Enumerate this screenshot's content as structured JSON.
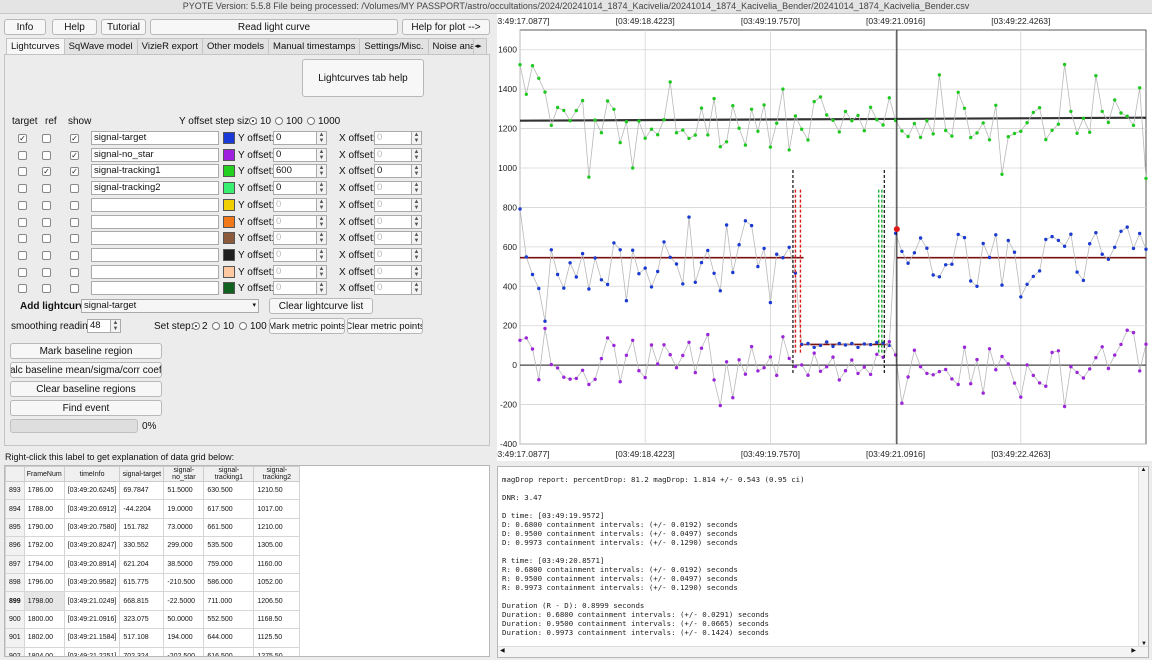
{
  "window_title": "PYOTE Version: 5.5.8  File being processed: /Volumes/MY PASSPORT/astro/occultations/2024/20241014_1874_Kacivelia/20241014_1874_Kacivelia_Bender/20241014_1874_Kacivelia_Bender.csv",
  "toolbar": {
    "info": "Info",
    "help": "Help",
    "tutorial": "Tutorial",
    "read_lightcurve": "Read light curve",
    "help_plot": "Help for plot -->"
  },
  "tabs": [
    "Lightcurves",
    "SqWave model",
    "VizieR export",
    "Other models",
    "Manual timestamps",
    "Settings/Misc.",
    "Noise analysis/"
  ],
  "lightcurves_tab_help": "Lightcurves tab help",
  "col_headers": {
    "target": "target",
    "ref": "ref",
    "show": "show",
    "offset_step": "Y offset step size:"
  },
  "offset_steps": [
    "10",
    "100",
    "1000"
  ],
  "y_offset_label": "Y offset:",
  "x_offset_label": "X offset:",
  "curves": [
    {
      "name": "signal-target",
      "color": "#1a3ad8",
      "target": true,
      "ref": false,
      "show": true,
      "y": "0",
      "x": "0",
      "active": true
    },
    {
      "name": "signal-no_star",
      "color": "#a020e0",
      "target": false,
      "ref": false,
      "show": true,
      "y": "0",
      "x": "0",
      "active": true
    },
    {
      "name": "signal-tracking1",
      "color": "#22d022",
      "target": false,
      "ref": true,
      "show": true,
      "y": "600",
      "x": "0",
      "active": true
    },
    {
      "name": "signal-tracking2",
      "color": "#38ef70",
      "target": false,
      "ref": false,
      "show": false,
      "y": "0",
      "x": "0",
      "active": true
    },
    {
      "name": "",
      "color": "#f0d000",
      "target": false,
      "ref": false,
      "show": false,
      "y": "0",
      "x": "0",
      "active": false
    },
    {
      "name": "",
      "color": "#f07818",
      "target": false,
      "ref": false,
      "show": false,
      "y": "0",
      "x": "0",
      "active": false
    },
    {
      "name": "",
      "color": "#8b5a3c",
      "target": false,
      "ref": false,
      "show": false,
      "y": "0",
      "x": "0",
      "active": false
    },
    {
      "name": "",
      "color": "#202020",
      "target": false,
      "ref": false,
      "show": false,
      "y": "0",
      "x": "0",
      "active": false
    },
    {
      "name": "",
      "color": "#ffc8a0",
      "target": false,
      "ref": false,
      "show": false,
      "y": "0",
      "x": "0",
      "active": false
    },
    {
      "name": "",
      "color": "#106020",
      "target": false,
      "ref": false,
      "show": false,
      "y": "0",
      "x": "0",
      "active": false
    }
  ],
  "add_lightcurve_label": "Add lightcurve",
  "add_lightcurve_value": "signal-target",
  "clear_lightcurve_list": "Clear lightcurve list",
  "smoothing_label": "smoothing readings",
  "smoothing_value": "48",
  "set_step_label": "Set step:",
  "set_steps": [
    "2",
    "10",
    "100"
  ],
  "mark_metric": "Mark metric points",
  "clear_metric": "Clear metric points",
  "mark_baseline": "Mark baseline region",
  "calc_baseline": "Calc baseline mean/sigma/corr coeffs",
  "clear_baseline": "Clear baseline regions",
  "find_event": "Find event",
  "progress_percent": "0%",
  "progress_value": 0,
  "grid_hint": "Right-click this label to get explanation of data grid below:",
  "grid": {
    "headers": [
      "FrameNum",
      "timeInfo",
      "signal-target",
      "signal-no_star",
      "signal-tracking1",
      "signal-tracking2"
    ],
    "rows": [
      {
        "id": "893",
        "cells": [
          "1786.00",
          "[03:49:20.6245]",
          "69.7847",
          "51.5000",
          "630.500",
          "1210.50"
        ]
      },
      {
        "id": "894",
        "cells": [
          "1788.00",
          "[03:49:20.6912]",
          "-44.2204",
          "19.0000",
          "617.500",
          "1017.00"
        ]
      },
      {
        "id": "895",
        "cells": [
          "1790.00",
          "[03:49:20.7580]",
          "151.782",
          "73.0000",
          "661.500",
          "1210.00"
        ]
      },
      {
        "id": "896",
        "cells": [
          "1792.00",
          "[03:49:20.8247]",
          "330.552",
          "299.000",
          "535.500",
          "1305.00"
        ]
      },
      {
        "id": "897",
        "cells": [
          "1794.00",
          "[03:49:20.8914]",
          "621.204",
          "38.5000",
          "759.000",
          "1160.00"
        ]
      },
      {
        "id": "898",
        "cells": [
          "1796.00",
          "[03:49:20.9582]",
          "615.775",
          "-210.500",
          "586.000",
          "1052.00"
        ]
      },
      {
        "id": "899",
        "cells": [
          "1798.00",
          "[03:49:21.0249]",
          "668.815",
          "-22.5000",
          "711.000",
          "1206.50"
        ]
      },
      {
        "id": "900",
        "cells": [
          "1800.00",
          "[03:49:21.0916]",
          "323.075",
          "50.0000",
          "552.500",
          "1168.50"
        ]
      },
      {
        "id": "901",
        "cells": [
          "1802.00",
          "[03:49:21.1584]",
          "517.108",
          "194.000",
          "644.000",
          "1125.50"
        ]
      },
      {
        "id": "902",
        "cells": [
          "1804.00",
          "[03:49:21.2251]",
          "702.324",
          "-202.500",
          "616.500",
          "1275.50"
        ]
      }
    ]
  },
  "chart_data": {
    "type": "line",
    "top_ticks": [
      "[03:49:17.0877]",
      "[03:49:18.4223]",
      "[03:49:19.7570]",
      "[03:49:21.0916]",
      "[03:49:22.4263]"
    ],
    "bottom_ticks": [
      "[03:49:17.0877]",
      "[03:49:18.4223]",
      "[03:49:19.7570]",
      "[03:49:21.0916]",
      "[03:49:22.4263]"
    ],
    "y_ticks": [
      "1600",
      "1400",
      "1200",
      "1000",
      "800",
      "600",
      "400",
      "200",
      "0",
      "-200",
      "-400"
    ],
    "ylim": [
      -400,
      1700
    ],
    "grid": true,
    "frames": 100,
    "baseline_tracking1": 1240,
    "baseline_target": 545,
    "event_level": 105,
    "zero_line": 0,
    "d_frame": 45.3,
    "r_frame": 58.8,
    "d_error_frames": [
      44.0,
      44.8
    ],
    "r_error_frames": [
      57.3,
      57.8
    ],
    "edge_frames": [
      43.6,
      58.2
    ],
    "cursor_frame": 60.2,
    "red_point": {
      "frame": 60.2,
      "value": 690
    },
    "series": [
      {
        "name": "signal-tracking1",
        "color": "#22c822",
        "values": [
          1524,
          1374,
          1519,
          1455,
          1385,
          1216,
          1307,
          1292,
          1240,
          1291,
          1342,
          954,
          1243,
          1179,
          1340,
          1298,
          1129,
          1235,
          1000,
          1238,
          1151,
          1197,
          1169,
          1245,
          1436,
          1179,
          1192,
          1150,
          1167,
          1304,
          1168,
          1352,
          1108,
          1133,
          1316,
          1202,
          1116,
          1298,
          1186,
          1320,
          1106,
          1227,
          1400,
          1092,
          1264,
          1197,
          1142,
          1337,
          1360,
          1269,
          1242,
          1183,
          1287,
          1240,
          1267,
          1189,
          1308,
          1245,
          1218,
          1356,
          1241,
          1188,
          1160,
          1225,
          1155,
          1240,
          1173,
          1472,
          1190,
          1162,
          1384,
          1303,
          1154,
          1178,
          1229,
          1143,
          1318,
          968,
          1159,
          1175,
          1186,
          1230,
          1282,
          1306,
          1144,
          1191,
          1222,
          1525,
          1287,
          1176,
          1252,
          1181,
          1468,
          1287,
          1231,
          1345,
          1279,
          1263,
          1216,
          1407,
          947
        ]
      },
      {
        "name": "signal-target",
        "color": "#1a3ad0",
        "values": [
          792,
          549,
          460,
          389,
          223,
          585,
          460,
          391,
          519,
          447,
          566,
          386,
          544,
          433,
          409,
          620,
          585,
          327,
          583,
          464,
          492,
          397,
          475,
          625,
          547,
          513,
          412,
          751,
          420,
          520,
          582,
          466,
          377,
          711,
          470,
          611,
          732,
          708,
          500,
          592,
          317,
          563,
          545,
          598,
          467,
          105,
          110,
          90,
          100,
          118,
          95,
          110,
          102,
          110,
          90,
          108,
          104,
          115,
          112,
          100,
          669,
          577,
          517,
          570,
          645,
          593,
          457,
          448,
          509,
          512,
          663,
          647,
          427,
          400,
          617,
          546,
          661,
          406,
          632,
          573,
          346,
          410,
          450,
          478,
          638,
          652,
          633,
          603,
          664,
          472,
          430,
          616,
          672,
          563,
          537,
          598,
          679,
          700,
          592,
          668,
          588
        ]
      },
      {
        "name": "signal-no_star",
        "color": "#9a26d8",
        "values": [
          126,
          138,
          82,
          -74,
          186,
          3,
          -14,
          -61,
          -71,
          -67,
          -26,
          -98,
          -72,
          33,
          138,
          100,
          -84,
          50,
          126,
          -28,
          -63,
          102,
          6,
          103,
          53,
          -13,
          49,
          116,
          -38,
          86,
          155,
          -75,
          -205,
          17,
          -165,
          27,
          -46,
          94,
          -29,
          -13,
          42,
          -52,
          144,
          34,
          -7,
          1,
          -51,
          61,
          -31,
          -8,
          41,
          -75,
          -28,
          26,
          -42,
          -10,
          -47,
          55,
          40,
          119,
          52,
          -193,
          -60,
          76,
          -8,
          -42,
          -49,
          -33,
          -22,
          -70,
          -98,
          91,
          -94,
          28,
          -142,
          83,
          -23,
          44,
          6,
          -91,
          -162,
          1,
          -52,
          -90,
          -107,
          64,
          73,
          -210,
          -8,
          -37,
          -65,
          -19,
          38,
          93,
          -17,
          51,
          105,
          177,
          165,
          -29,
          106
        ]
      }
    ]
  },
  "report_lines": [
    "magDrop report: percentDrop: 81.2 magDrop: 1.814 +/- 0.543 (0.95 ci)",
    "",
    "DNR: 3.47",
    "",
    "D time: [03:49:19.9572]",
    "D: 0.6800 containment intervals: (+/- 0.0192) seconds",
    "D: 0.9500 containment intervals: (+/- 0.0497) seconds",
    "D: 0.9973 containment intervals: (+/- 0.1290) seconds",
    "",
    "R time: [03:49:20.8571]",
    "R: 0.6800 containment intervals: (+/- 0.0192) seconds",
    "R: 0.9500 containment intervals: (+/- 0.0497) seconds",
    "R: 0.9973 containment intervals: (+/- 0.1290) seconds",
    "",
    "Duration (R - D): 0.8999 seconds",
    "Duration: 0.6800 containment intervals: (+/- 0.0291) seconds",
    "Duration: 0.9500 containment intervals: (+/- 0.0665) seconds",
    "Duration: 0.9973 containment intervals: (+/- 0.1424) seconds"
  ]
}
